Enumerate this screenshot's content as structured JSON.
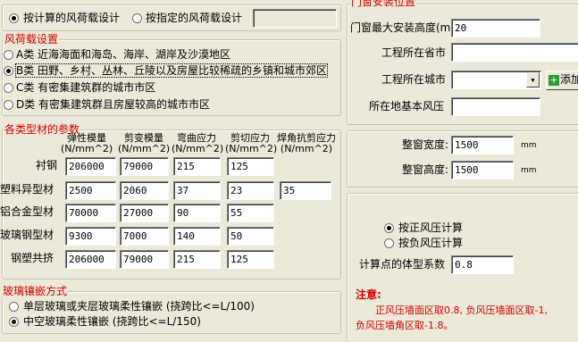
{
  "calc_mode": {
    "options": [
      "按计算的风荷载设计",
      "按指定的风荷载设计"
    ],
    "selected": 0,
    "specified_value": ""
  },
  "wind_load": {
    "title": "风荷载设置",
    "options": [
      "A类  近海海面和海岛、海岸、湖岸及沙漠地区",
      "B类 田野、乡村、丛林、丘陵以及房屋比较稀疏的乡镇和城市郊区",
      "C类  有密集建筑群的城市市区",
      "D类  有密集建筑群且房屋较高的城市市区"
    ],
    "selected": 1
  },
  "profiles": {
    "title": "各类型材的参数",
    "headers": [
      "弹性模量 (N/mm^2)",
      "剪变模量 (N/mm^2)",
      "弯曲应力 (N/mm^2)",
      "剪切应力 (N/mm^2)",
      "焊角抗剪应力(N/mm^2)"
    ],
    "rows": [
      {
        "label": "衬钢",
        "values": [
          "206000",
          "79000",
          "215",
          "125"
        ]
      },
      {
        "label": "塑料异型材",
        "values": [
          "2500",
          "2060",
          "37",
          "23",
          "35"
        ]
      },
      {
        "label": "铝合金型材",
        "values": [
          "70000",
          "27000",
          "90",
          "55"
        ]
      },
      {
        "label": "玻璃钢型材",
        "values": [
          "9300",
          "7000",
          "140",
          "50"
        ]
      },
      {
        "label": "钢塑共挤",
        "values": [
          "206000",
          "79000",
          "215",
          "125"
        ]
      }
    ]
  },
  "glass": {
    "title": "玻璃镶嵌方式",
    "options": [
      "单层玻璃或夹层玻璃柔性镶嵌 (挠跨比<=L/100)",
      "中空玻璃柔性镶嵌 (挠跨比<=L/150)"
    ],
    "selected": 1
  },
  "location": {
    "title": "门窗安装位置",
    "height_label": "门窗最大安装高度(m)",
    "height_value": "20",
    "province_label": "工程所在省市",
    "province_value": "",
    "city_label": "工程所在城市",
    "city_value": "",
    "add_button": "添加",
    "pressure_label": "所在地基本风压",
    "pressure_value": ""
  },
  "window_size": {
    "width_label": "整窗宽度:",
    "width_value": "1500",
    "height_label": "整窗高度:",
    "height_value": "1500",
    "unit": "mm"
  },
  "pressure": {
    "options": [
      "按正风压计算",
      "按负风压计算"
    ],
    "selected": 0,
    "shape_label": "计算点的体型系数",
    "shape_value": "0.8",
    "note_title": "注意:",
    "note_line1": "正风压墙面区取0.8, 负风压墙面区取-1,",
    "note_line2": "负风压墙角区取-1.8。"
  }
}
